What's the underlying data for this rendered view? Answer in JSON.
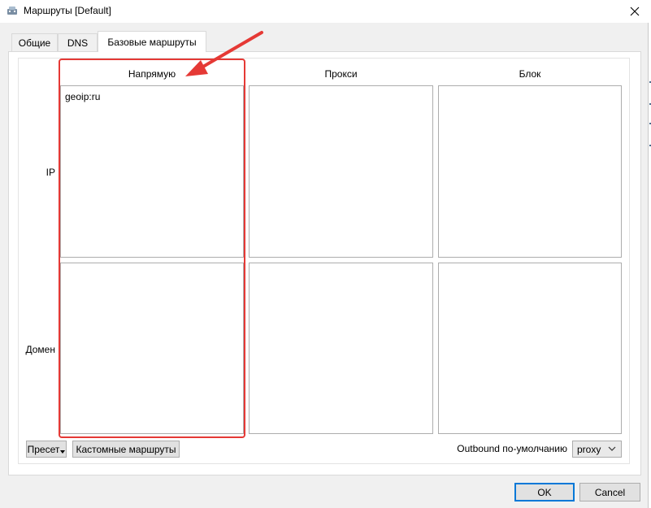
{
  "window": {
    "title": "Маршруты [Default]",
    "icons": {
      "app": "app-icon",
      "close": "close-icon"
    }
  },
  "tabs": [
    {
      "label": "Общие",
      "active": false
    },
    {
      "label": "DNS",
      "active": false
    },
    {
      "label": "Базовые маршруты",
      "active": true
    }
  ],
  "grid": {
    "columns": [
      "Напрямую",
      "Прокси",
      "Блок"
    ],
    "rows": [
      "IP",
      "Домен"
    ],
    "cells": {
      "ip_direct": [
        "geoip:ru"
      ],
      "ip_proxy": [],
      "ip_block": [],
      "domain_direct": [],
      "domain_proxy": [],
      "domain_block": []
    }
  },
  "footer": {
    "preset_label": "Пресет",
    "custom_routes_label": "Кастомные маршруты",
    "outbound_label": "Outbound по-умолчанию",
    "outbound_value": "proxy"
  },
  "dialog": {
    "ok_label": "OK",
    "cancel_label": "Cancel"
  },
  "annotation": {
    "color": "#e53935"
  }
}
